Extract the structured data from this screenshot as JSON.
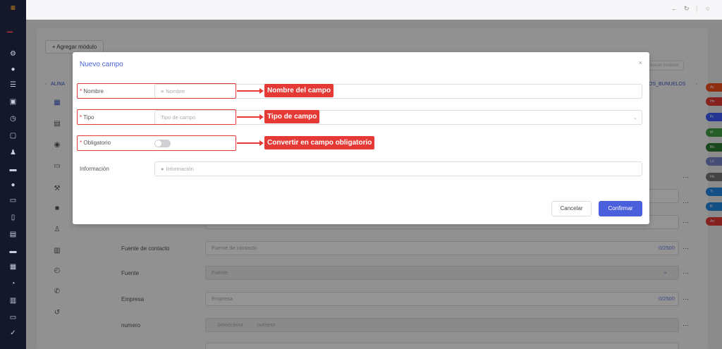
{
  "topbar": {
    "icons": [
      "arrow-left-icon",
      "refresh-icon",
      "power-icon"
    ]
  },
  "background": {
    "add_module": "+ Agregar módulo",
    "search_placeholder": "Buscar módulos",
    "tab_left": "ALINA",
    "tab_right": "OS_BUNUELOS",
    "rows": [
      {
        "label": "Fuente de contacto",
        "placeholder": "Fuente de contacto",
        "counter": "0/2500"
      },
      {
        "label": "Fuente",
        "placeholder": "Fuente"
      },
      {
        "label": "Empresa",
        "placeholder": "Empresa",
        "counter": "0/2500"
      },
      {
        "label": "numero",
        "select": "Selecciona",
        "placeholder": "numero"
      }
    ],
    "pills": [
      {
        "text": "Ac",
        "color": "#f4511e"
      },
      {
        "text": "He",
        "color": "#e53935"
      },
      {
        "text": "Pr",
        "color": "#3d5afe"
      },
      {
        "text": "M",
        "color": "#43a047"
      },
      {
        "text": "Bo",
        "color": "#2e7d32"
      },
      {
        "text": "Lo",
        "color": "#7986cb"
      },
      {
        "text": "He",
        "color": "#757575"
      },
      {
        "text": "Tr",
        "color": "#1e88e5"
      },
      {
        "text": "B.",
        "color": "#1e88e5"
      },
      {
        "text": "An",
        "color": "#e53935"
      }
    ]
  },
  "modal": {
    "title": "Nuevo campo",
    "close": "×",
    "fields": {
      "nombre": {
        "label": "Nombre",
        "placeholder": "Nombre",
        "required": "*"
      },
      "tipo": {
        "label": "Tipo",
        "placeholder": "Tipo de campo",
        "required": "*"
      },
      "obligatorio": {
        "label": "Obligatorio",
        "required": "*"
      },
      "informacion": {
        "label": "Información",
        "placeholder": "Información"
      }
    },
    "cancel": "Cancelar",
    "confirm": "Confirmar"
  },
  "annotations": {
    "nombre": "Nombre del campo",
    "tipo": "Tipo de campo",
    "obligatorio": "Convertir en campo obligatorio"
  },
  "colors": {
    "accent": "#4a5fdc",
    "annotation": "#e53935",
    "sidebar": "#15182b"
  }
}
